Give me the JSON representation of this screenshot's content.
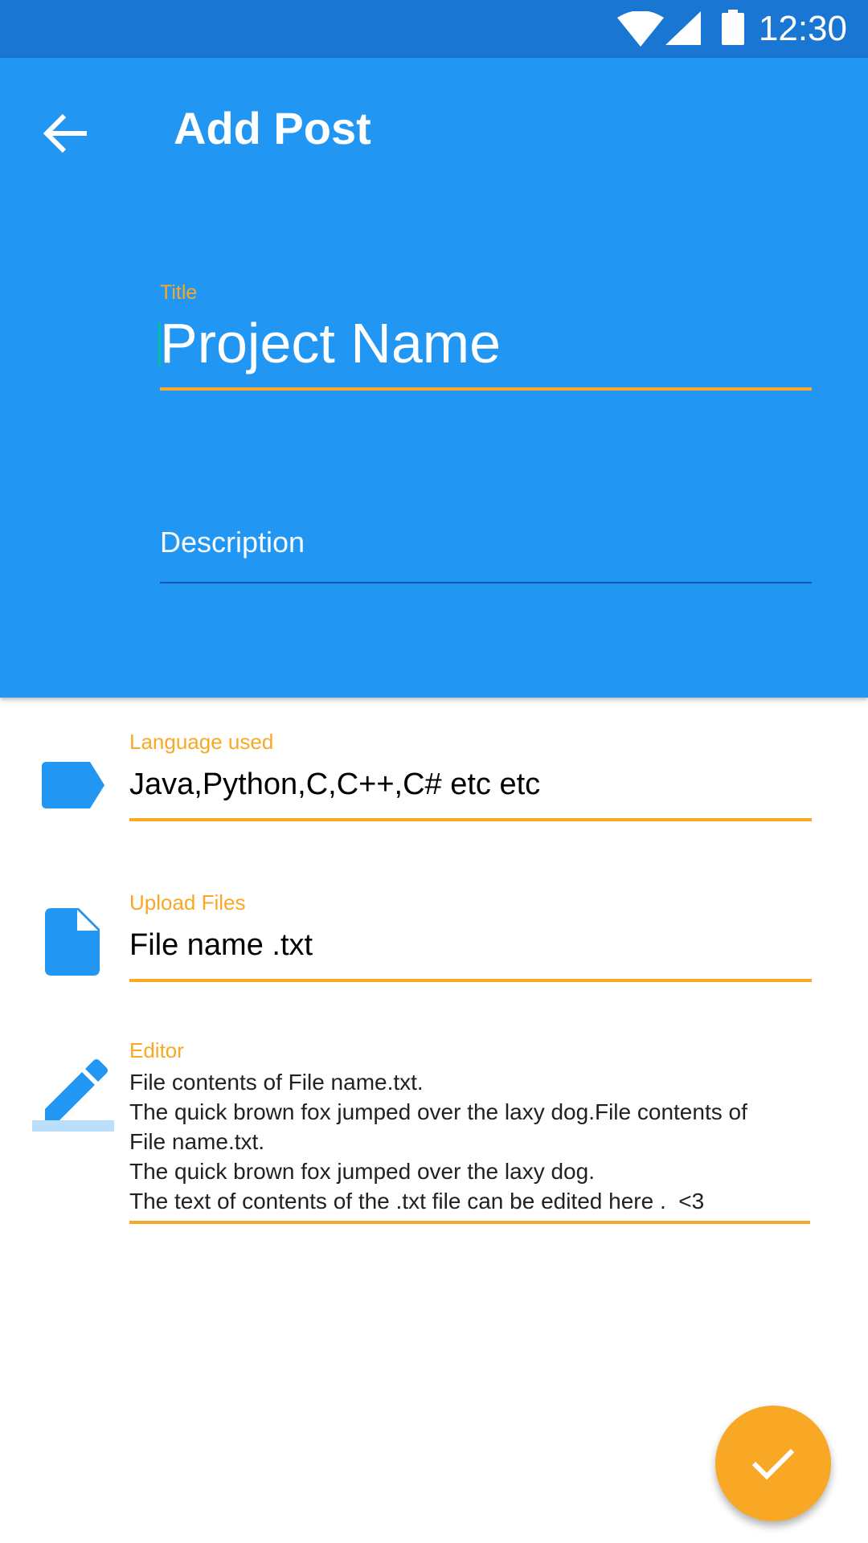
{
  "status_bar": {
    "time": "12:30",
    "icons": [
      "wifi-icon",
      "cell-signal-icon",
      "battery-icon"
    ]
  },
  "app_bar": {
    "title": "Add Post",
    "back_icon": "arrow-back-icon",
    "background_color": "#2196F3",
    "status_color": "#1976D2"
  },
  "form": {
    "title_field": {
      "label": "Title",
      "value": "Project Name"
    },
    "description_field": {
      "placeholder": "Description"
    },
    "language_field": {
      "label": "Language used",
      "value": "Java,Python,C,C++,C# etc etc",
      "icon": "label-icon"
    },
    "upload_field": {
      "label": "Upload Files",
      "value": "File name .txt",
      "icon": "file-icon"
    },
    "editor_field": {
      "label": "Editor",
      "icon": "edit-icon",
      "lines": [
        "File contents of File name.txt.",
        "The quick brown fox jumped over the laxy dog.File contents of",
        "File name.txt.",
        "The quick brown fox jumped over the laxy dog.",
        "The text of contents of the .txt file can be edited here .  <3"
      ]
    }
  },
  "fab": {
    "icon": "check-icon",
    "color": "#F9A825"
  },
  "accent_color": "#F9A825"
}
